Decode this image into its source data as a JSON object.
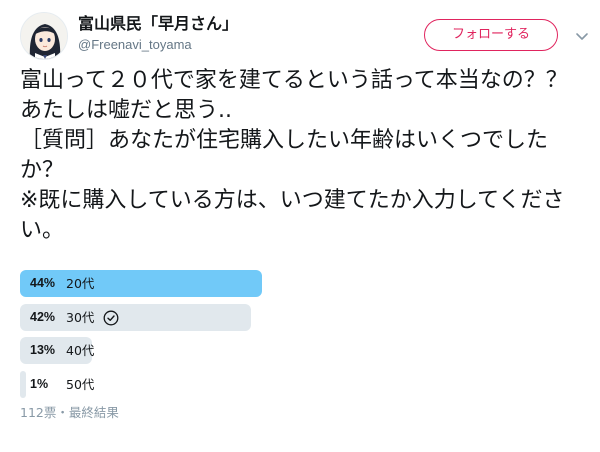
{
  "author": {
    "display_name": "富山県民「早月さん」",
    "screen_name": "@Freenavi_toyama"
  },
  "follow_label": "フォローする",
  "tweet_text": "富山って２０代で家を建てるという話って本当なの？？あたしは嘘だと思う..\n［質問］あなたが住宅購入したい年齢はいくつでしたか？\n※既に購入している方は、いつ建てたか入力してください。",
  "poll": {
    "options": [
      {
        "percent_label": "44%",
        "label": "20代",
        "percent": 44,
        "winner": true,
        "user_voted": false
      },
      {
        "percent_label": "42%",
        "label": "30代",
        "percent": 42,
        "winner": false,
        "user_voted": true
      },
      {
        "percent_label": "13%",
        "label": "40代",
        "percent": 13,
        "winner": false,
        "user_voted": false
      },
      {
        "percent_label": "1%",
        "label": "50代",
        "percent": 1,
        "winner": false,
        "user_voted": false
      }
    ],
    "meta": "112票・最終結果"
  },
  "colors": {
    "accent": "#e0245e",
    "winner_bar": "#71c9f8",
    "bar": "#e1e8ed",
    "muted": "#8899a6"
  },
  "icons": {
    "caret": "chevron-down-icon",
    "vote": "check-circle-icon"
  }
}
